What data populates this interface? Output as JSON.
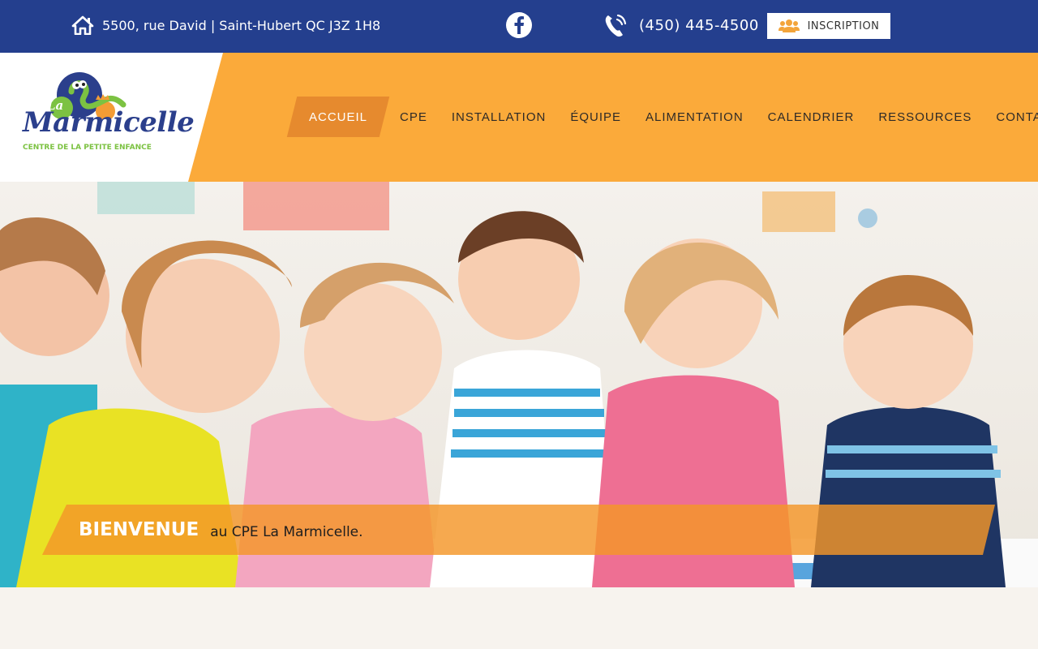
{
  "topbar": {
    "address": "5500, rue David | Saint-Hubert QC J3Z 1H8",
    "phone": "(450) 445-4500",
    "inscription_label": "INSCRIPTION",
    "icons": [
      "home-icon",
      "facebook-icon",
      "phone-icon",
      "users-icon"
    ]
  },
  "logo": {
    "la": "La",
    "name": "Marmicelle",
    "tagline": "CENTRE DE LA PETITE ENFANCE"
  },
  "nav": {
    "items": [
      {
        "label": "ACCUEIL",
        "active": true
      },
      {
        "label": "CPE"
      },
      {
        "label": "INSTALLATION"
      },
      {
        "label": "ÉQUIPE"
      },
      {
        "label": "ALIMENTATION"
      },
      {
        "label": "CALENDRIER"
      },
      {
        "label": "RESSOURCES"
      },
      {
        "label": "CONTACT"
      }
    ]
  },
  "hero": {
    "welcome_title": "BIENVENUE",
    "welcome_text": "au CPE La Marmicelle."
  },
  "colors": {
    "topbar": "#243f8e",
    "header_orange": "#fbaa3a",
    "nav_active": "#e68a2e",
    "logo_blue": "#2b3f8c",
    "logo_green": "#7cc242"
  }
}
